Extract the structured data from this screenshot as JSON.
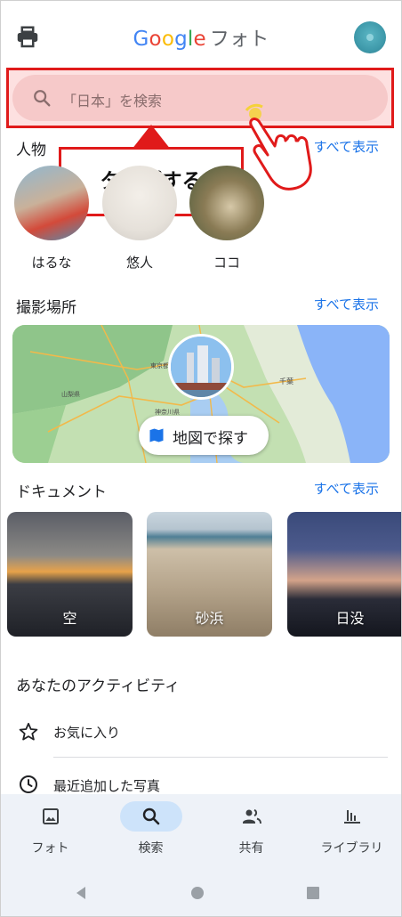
{
  "header": {
    "logo": {
      "g1": "G",
      "g2": "o",
      "g3": "o",
      "g4": "g",
      "g5": "l",
      "g6": "e",
      "suffix": "フォト"
    },
    "print_icon": "printer-icon",
    "account_icon": "account-avatar"
  },
  "search": {
    "placeholder": "「日本」を検索",
    "icon": "search-icon"
  },
  "callout": {
    "text": "タップする",
    "border_color": "#e01a1a"
  },
  "people": {
    "title": "人物",
    "see_all": "すべて表示",
    "items": [
      {
        "name": "はるな"
      },
      {
        "name": "悠人"
      },
      {
        "name": "ココ"
      }
    ]
  },
  "places": {
    "title": "撮影場所",
    "see_all": "すべて表示",
    "map_button": "地図で探す",
    "map_labels": [
      "千葉",
      "東京都",
      "山梨県",
      "神奈川県"
    ]
  },
  "documents": {
    "title": "ドキュメント",
    "see_all": "すべて表示",
    "items": [
      {
        "label": "空"
      },
      {
        "label": "砂浜"
      },
      {
        "label": "日没"
      }
    ]
  },
  "activity": {
    "title": "あなたのアクティビティ",
    "items": [
      {
        "label": "お気に入り",
        "icon": "star-icon"
      },
      {
        "label": "最近追加した写真",
        "icon": "clock-icon"
      }
    ]
  },
  "bottom_nav": {
    "items": [
      {
        "label": "フォト",
        "icon": "photo-icon",
        "active": false
      },
      {
        "label": "検索",
        "icon": "search-icon",
        "active": true
      },
      {
        "label": "共有",
        "icon": "people-icon",
        "active": false
      },
      {
        "label": "ライブラリ",
        "icon": "library-icon",
        "active": false
      }
    ]
  },
  "colors": {
    "accent": "#1a73e8",
    "highlight_red": "#e01a1a",
    "nav_active": "#cde3fa",
    "nav_bg": "#eef2f8"
  }
}
